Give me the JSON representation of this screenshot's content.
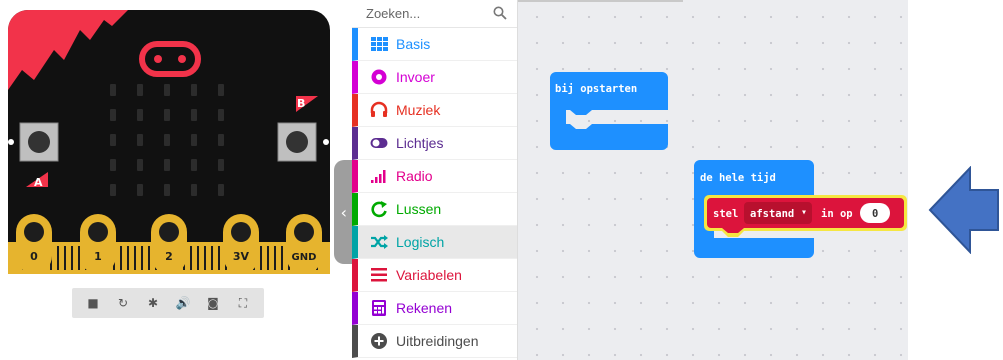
{
  "simulator": {
    "pin_labels": [
      "0",
      "1",
      "2",
      "3V",
      "GND"
    ],
    "button_a": "A",
    "button_b": "B",
    "toolbar": {
      "stop": "■",
      "restart": "↻",
      "debug": "✱",
      "mute": "🔊",
      "screenshot": "◙",
      "fullscreen": "⛶"
    },
    "splitter_glyph": "‹"
  },
  "toolbox": {
    "search_placeholder": "Zoeken...",
    "categories": [
      {
        "label": "Basis",
        "color": "#1e90ff",
        "icon": "grid-icon"
      },
      {
        "label": "Invoer",
        "color": "#d400d4",
        "icon": "target-icon"
      },
      {
        "label": "Muziek",
        "color": "#e63022",
        "icon": "headphones-icon"
      },
      {
        "label": "Lichtjes",
        "color": "#5c2d91",
        "icon": "toggle-icon"
      },
      {
        "label": "Radio",
        "color": "#e3008c",
        "icon": "signal-bars-icon"
      },
      {
        "label": "Lussen",
        "color": "#00aa00",
        "icon": "loop-icon"
      },
      {
        "label": "Logisch",
        "color": "#00a4a6",
        "icon": "shuffle-icon"
      },
      {
        "label": "Variabelen",
        "color": "#dc143c",
        "icon": "lines-icon"
      },
      {
        "label": "Rekenen",
        "color": "#9400d3",
        "icon": "calculator-icon"
      },
      {
        "label": "Uitbreidingen",
        "color": "#4c4c4c",
        "icon": "plus-circle-icon"
      }
    ],
    "selected": "Logisch"
  },
  "workspace": {
    "on_start": {
      "label": "bij opstarten",
      "color": "#1e90ff"
    },
    "forever": {
      "label": "de hele tijd",
      "color": "#1e90ff"
    },
    "set_var": {
      "prefix": "stel",
      "variable": "afstand",
      "dropdown_glyph": "▾",
      "middle": "in op",
      "value": "0",
      "color": "#dc143c",
      "highlight": "#f5e642"
    }
  },
  "annotation": {
    "arrow_color": "#4472c4",
    "arrow_border": "#2f5597"
  }
}
